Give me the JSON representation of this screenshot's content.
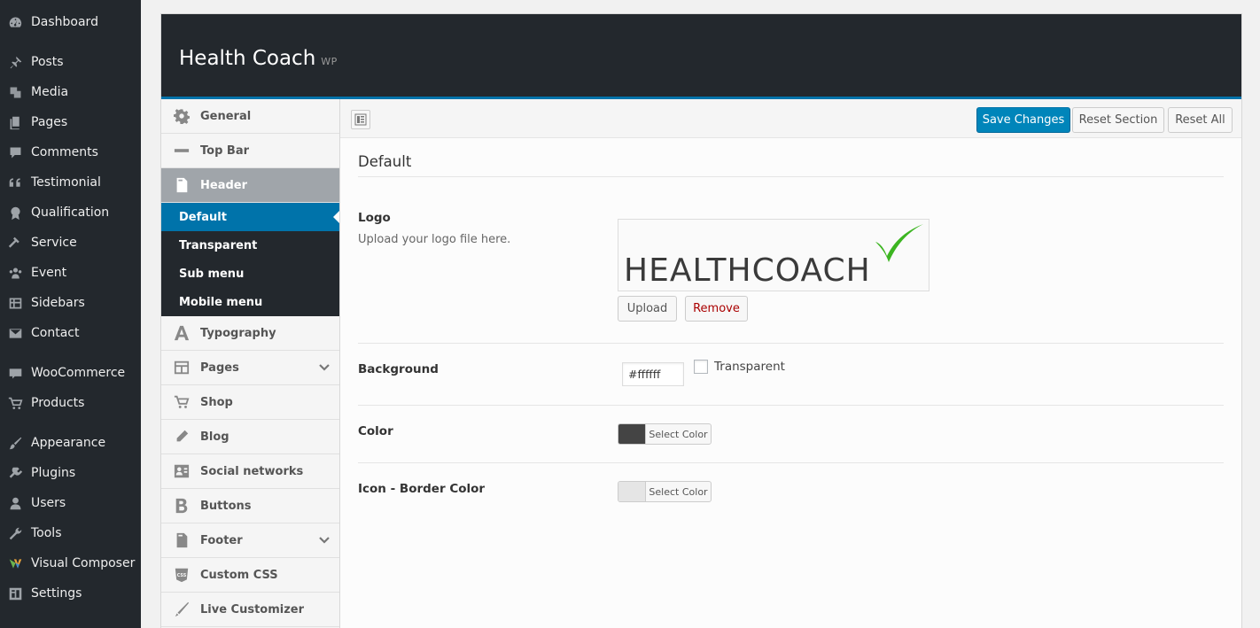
{
  "wp_menu": [
    {
      "label": "Dashboard",
      "icon": "dashboard-icon"
    },
    {
      "label": "Posts",
      "icon": "pin-icon"
    },
    {
      "label": "Media",
      "icon": "media-icon"
    },
    {
      "label": "Pages",
      "icon": "pages-icon"
    },
    {
      "label": "Comments",
      "icon": "comment-icon"
    },
    {
      "label": "Testimonial",
      "icon": "quote-icon"
    },
    {
      "label": "Qualification",
      "icon": "award-icon"
    },
    {
      "label": "Service",
      "icon": "hammer-icon"
    },
    {
      "label": "Event",
      "icon": "groups-icon"
    },
    {
      "label": "Sidebars",
      "icon": "grid-icon"
    },
    {
      "label": "Contact",
      "icon": "email-icon"
    },
    {
      "label": "WooCommerce",
      "icon": "woo-icon"
    },
    {
      "label": "Products",
      "icon": "cart-icon"
    },
    {
      "label": "Appearance",
      "icon": "brush-icon"
    },
    {
      "label": "Plugins",
      "icon": "plugin-icon"
    },
    {
      "label": "Users",
      "icon": "user-icon"
    },
    {
      "label": "Tools",
      "icon": "wrench-icon"
    },
    {
      "label": "Visual Composer",
      "icon": "vc-icon"
    },
    {
      "label": "Settings",
      "icon": "settings-icon"
    }
  ],
  "panel": {
    "title": "Health Coach",
    "subtitle": "WP"
  },
  "options_nav": {
    "items": [
      {
        "label": "General",
        "icon": "gear-icon"
      },
      {
        "label": "Top Bar",
        "icon": "minus-icon"
      },
      {
        "label": "Header",
        "icon": "document-icon",
        "active": true
      },
      {
        "label": "Typography",
        "icon": "letter-a-icon"
      },
      {
        "label": "Pages",
        "icon": "layout-icon",
        "expandable": true
      },
      {
        "label": "Shop",
        "icon": "cart-icon"
      },
      {
        "label": "Blog",
        "icon": "pencil-icon"
      },
      {
        "label": "Social networks",
        "icon": "contact-card-icon"
      },
      {
        "label": "Buttons",
        "icon": "letter-b-icon"
      },
      {
        "label": "Footer",
        "icon": "document-icon",
        "expandable": true
      },
      {
        "label": "Custom CSS",
        "icon": "css-icon"
      },
      {
        "label": "Live Customizer",
        "icon": "brush-icon"
      }
    ],
    "header_sub": [
      "Default",
      "Transparent",
      "Sub menu",
      "Mobile menu"
    ]
  },
  "toolbar": {
    "save": "Save Changes",
    "reset_section": "Reset Section",
    "reset_all": "Reset All"
  },
  "section": {
    "title": "Default"
  },
  "fields": {
    "logo": {
      "label": "Logo",
      "desc": "Upload your logo file here.",
      "logo_text": "HEALTHCOACH",
      "upload": "Upload",
      "remove": "Remove"
    },
    "background": {
      "label": "Background",
      "value": "#ffffff",
      "transparent_label": "Transparent"
    },
    "color": {
      "label": "Color",
      "select": "Select Color",
      "swatch": "#444444"
    },
    "icon_border": {
      "label": "Icon - Border Color",
      "select": "Select Color",
      "swatch": "#e5e5e5"
    }
  },
  "colors": {
    "accent": "#0073aa",
    "remove": "#a00",
    "check_green": "#3cb521"
  }
}
